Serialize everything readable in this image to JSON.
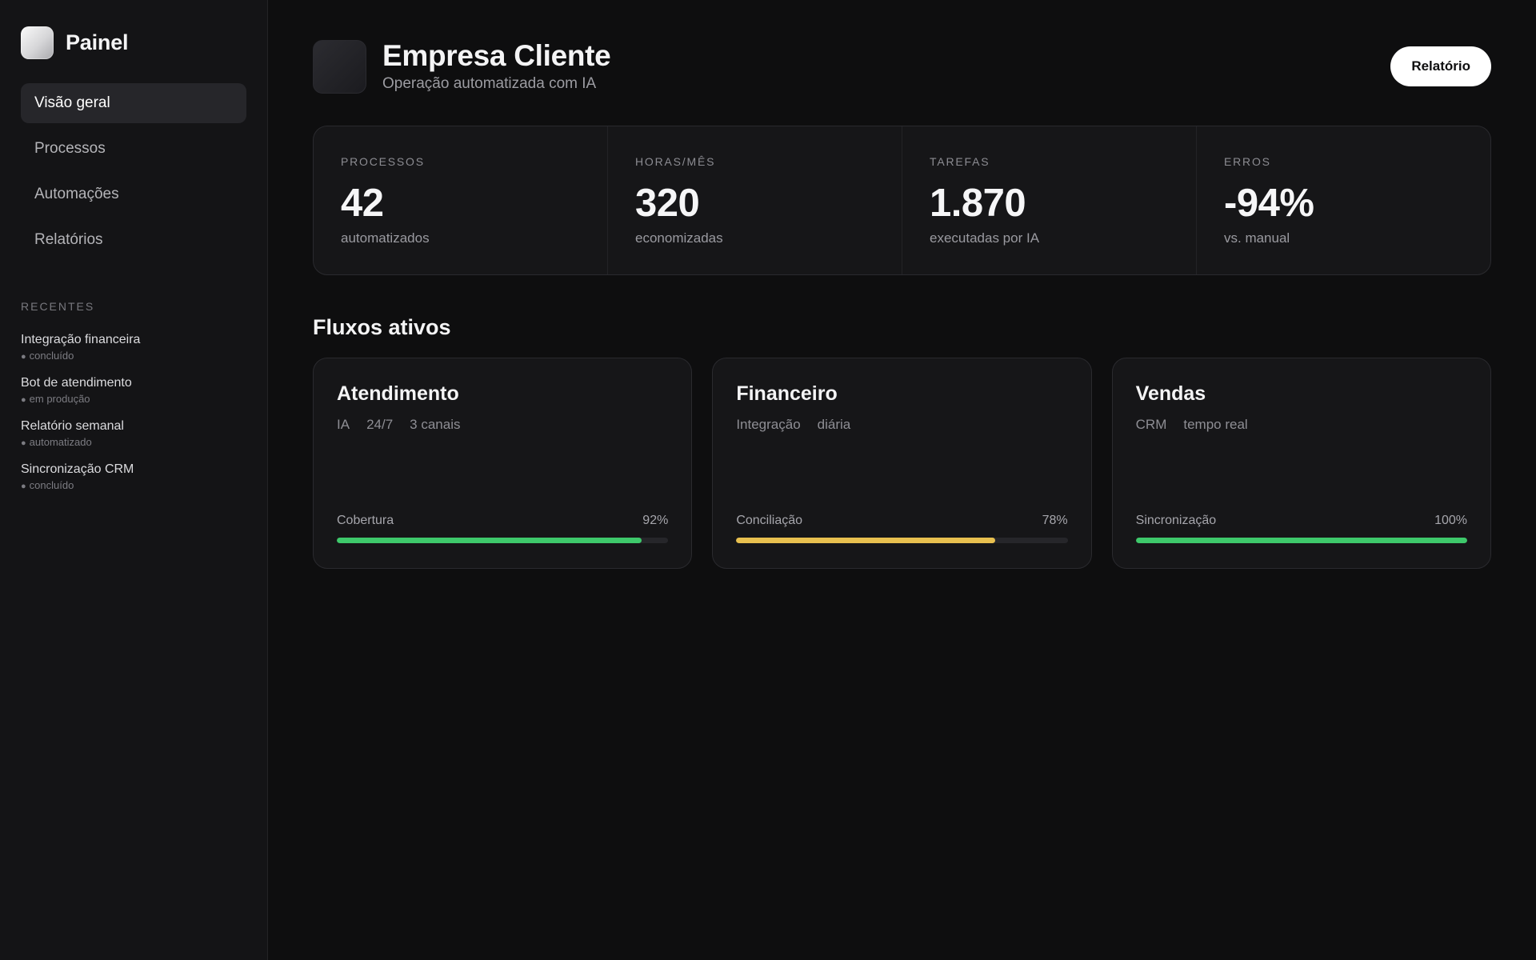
{
  "brand": {
    "name": "Painel"
  },
  "nav": [
    {
      "label": "Visão geral",
      "active": true
    },
    {
      "label": "Processos",
      "active": false
    },
    {
      "label": "Automações",
      "active": false
    },
    {
      "label": "Relatórios",
      "active": false
    }
  ],
  "recent": {
    "title": "RECENTES",
    "items": [
      {
        "name": "Integração financeira",
        "status": "concluído"
      },
      {
        "name": "Bot de atendimento",
        "status": "em produção"
      },
      {
        "name": "Relatório semanal",
        "status": "automatizado"
      },
      {
        "name": "Sincronização CRM",
        "status": "concluído"
      }
    ]
  },
  "header": {
    "title": "Empresa Cliente",
    "subtitle": "Operação automatizada com IA",
    "report_button": "Relatório"
  },
  "stats": [
    {
      "label": "PROCESSOS",
      "value": "42",
      "sub": "automatizados"
    },
    {
      "label": "HORAS/MÊS",
      "value": "320",
      "sub": "economizadas"
    },
    {
      "label": "TAREFAS",
      "value": "1.870",
      "sub": "executadas por IA"
    },
    {
      "label": "ERROS",
      "value": "-94%",
      "sub": "vs. manual"
    }
  ],
  "flows": {
    "title": "Fluxos ativos",
    "cards": [
      {
        "title": "Atendimento",
        "tags": [
          "IA",
          "24/7",
          "3 canais"
        ],
        "metric_label": "Cobertura",
        "metric_value": "92%",
        "progress": 0.92,
        "color": "#3ec96b"
      },
      {
        "title": "Financeiro",
        "tags": [
          "Integração",
          "diária"
        ],
        "metric_label": "Conciliação",
        "metric_value": "78%",
        "progress": 0.78,
        "color": "#e8c04f"
      },
      {
        "title": "Vendas",
        "tags": [
          "CRM",
          "tempo real"
        ],
        "metric_label": "Sincronização",
        "metric_value": "100%",
        "progress": 1.0,
        "color": "#3ec96b"
      }
    ]
  }
}
